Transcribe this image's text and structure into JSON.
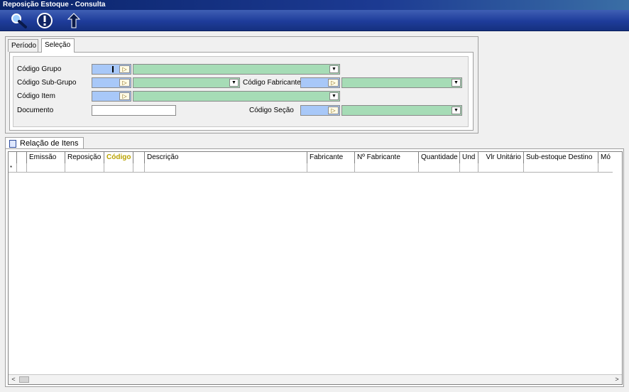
{
  "window": {
    "title": "Reposição Estoque - Consulta"
  },
  "toolbar": {
    "buttons": [
      {
        "icon": "magnifier-icon"
      },
      {
        "icon": "alert-icon"
      },
      {
        "icon": "back-arrow-icon"
      }
    ]
  },
  "tabs": {
    "periodo": "Período",
    "selecao": "Seleção"
  },
  "form": {
    "codigo_grupo": "Código Grupo",
    "codigo_subgrupo": "Código Sub-Grupo",
    "codigo_fabricante": "Código Fabricante",
    "codigo_item": "Código Item",
    "documento": "Documento",
    "codigo_secao": "Código Seção"
  },
  "grid": {
    "tab_label": "Relação de Itens",
    "columns": [
      "",
      "",
      "Emissão",
      "Reposição",
      "Código",
      "",
      "Descrição",
      "Fabricante",
      "Nº Fabricante",
      "Quantidade",
      "Und",
      "Vlr Unitário",
      "Sub-estoque Destino",
      "Mó"
    ],
    "new_row_marker": "*"
  },
  "colors": {
    "code_field": "#a8c8f8",
    "combo_field": "#a6dcb6",
    "highlight_header": "#b9a200"
  }
}
